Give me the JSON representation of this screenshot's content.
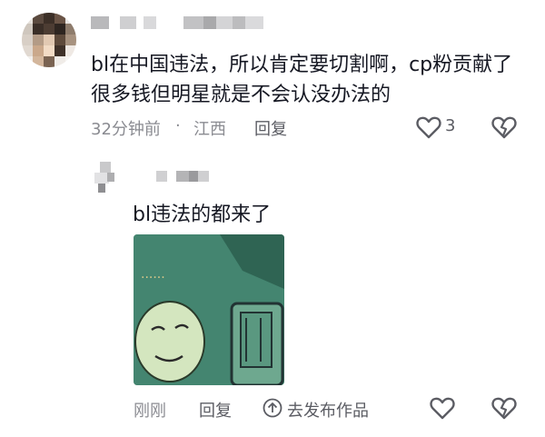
{
  "comment": {
    "text": "bl在中国违法，所以肯定要切割啊，cp粉贡献了很多钱但明星就是不会认没办法的",
    "time": "32分钟前",
    "separator": "·",
    "location": "江西",
    "reply_label": "回复",
    "like_count": "3"
  },
  "reply": {
    "text": "bl违法的都来了",
    "time": "刚刚",
    "reply_label": "回复",
    "publish_label": "去发布作品"
  },
  "icons": {
    "like": "heart-outline-icon",
    "dislike": "broken-heart-icon",
    "upload": "upload-circle-icon"
  },
  "colors": {
    "text": "#161823",
    "meta": "#8a8b91",
    "sticker_bg": "#3f7f6a"
  }
}
